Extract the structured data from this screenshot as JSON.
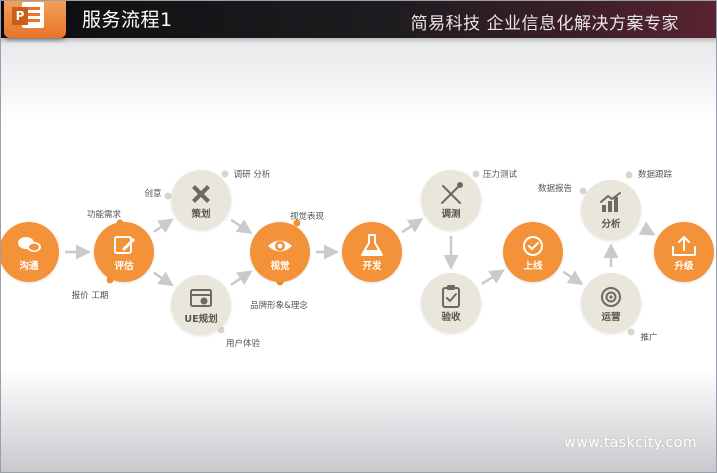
{
  "header": {
    "title": "服务流程1",
    "tagline": "简易科技  企业信息化解决方案专家"
  },
  "watermark": "www.taskcity.com",
  "colors": {
    "orange": "#f39237",
    "beige": "#e9e6dc",
    "arrow": "#c9cacc",
    "label_text": "#555555"
  },
  "diagram": {
    "nodes": [
      {
        "id": "goutong",
        "label": "沟通",
        "style": "orange",
        "icon": "speech-bubbles-icon"
      },
      {
        "id": "pinggu",
        "label": "评估",
        "style": "orange",
        "icon": "pencil-note-icon"
      },
      {
        "id": "cehua",
        "label": "策划",
        "style": "beige",
        "icon": "ruler-pencil-icon"
      },
      {
        "id": "ueguihua",
        "label": "UE规划",
        "style": "beige",
        "icon": "layout-chart-icon"
      },
      {
        "id": "shijue",
        "label": "视觉",
        "style": "orange",
        "icon": "eye-icon"
      },
      {
        "id": "kaifa",
        "label": "开发",
        "style": "orange",
        "icon": "flask-icon"
      },
      {
        "id": "tiaoce",
        "label": "调测",
        "style": "beige",
        "icon": "tools-icon"
      },
      {
        "id": "yanshou",
        "label": "验收",
        "style": "beige",
        "icon": "clipboard-check-icon"
      },
      {
        "id": "shangxian",
        "label": "上线",
        "style": "orange",
        "icon": "checkmark-icon"
      },
      {
        "id": "yunying",
        "label": "运营",
        "style": "beige",
        "icon": "target-icon"
      },
      {
        "id": "fenxi",
        "label": "分析",
        "style": "beige",
        "icon": "bar-chart-icon"
      },
      {
        "id": "shengji",
        "label": "升级",
        "style": "orange",
        "icon": "upload-tray-icon"
      }
    ],
    "annotations": [
      {
        "text": "功能需求"
      },
      {
        "text": "报价 工期"
      },
      {
        "text": "创意"
      },
      {
        "text": "调研 分析"
      },
      {
        "text": "视觉表现"
      },
      {
        "text": "品牌形象&理念"
      },
      {
        "text": "用户体验"
      },
      {
        "text": "压力测试"
      },
      {
        "text": "数据报告"
      },
      {
        "text": "数据跟踪"
      },
      {
        "text": "推广"
      }
    ]
  }
}
